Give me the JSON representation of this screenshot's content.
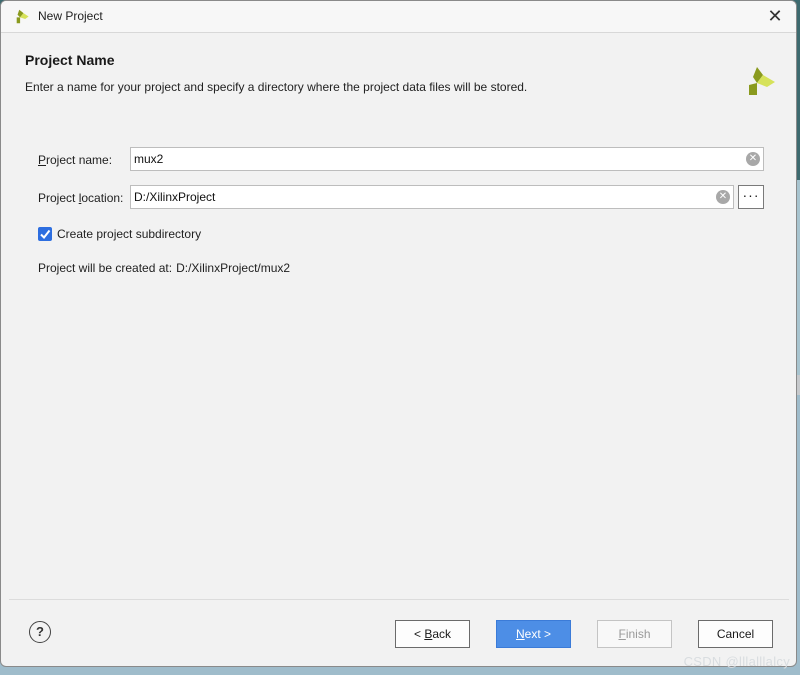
{
  "window": {
    "title": "New Project",
    "close_glyph": "✕"
  },
  "header": {
    "title": "Project Name",
    "description": "Enter a name for your project and specify a directory where the project data files will be stored."
  },
  "form": {
    "name_label_first": "P",
    "name_label_rest": "roject name:",
    "name_value": "mux2",
    "location_label_pre": "Project ",
    "location_label_underlined": "l",
    "location_label_post": "ocation:",
    "location_value": "D:/XilinxProject",
    "browse_label": "···",
    "subdirectory_checked": true,
    "subdirectory_label": "Create project subdirectory",
    "created_at_label": "Project will be created at:",
    "created_at_value": "D:/XilinxProject/mux2"
  },
  "footer": {
    "help_label": "?",
    "back_pre": "< ",
    "back_underlined": "B",
    "back_post": "ack",
    "next_underlined": "N",
    "next_post": "ext >",
    "finish_underlined": "F",
    "finish_post": "inish",
    "cancel_label": "Cancel"
  },
  "watermark": "CSDN @lllalllalcy",
  "colors": {
    "accent": "#4d8ee6",
    "logo_dark": "#8a9a1e",
    "logo_light": "#d6e25a"
  },
  "icons": {
    "app": "xilinx-logo-icon",
    "clear": "clear-circle-icon",
    "browse": "ellipsis-icon",
    "check": "checkmark-icon",
    "help": "help-icon"
  }
}
